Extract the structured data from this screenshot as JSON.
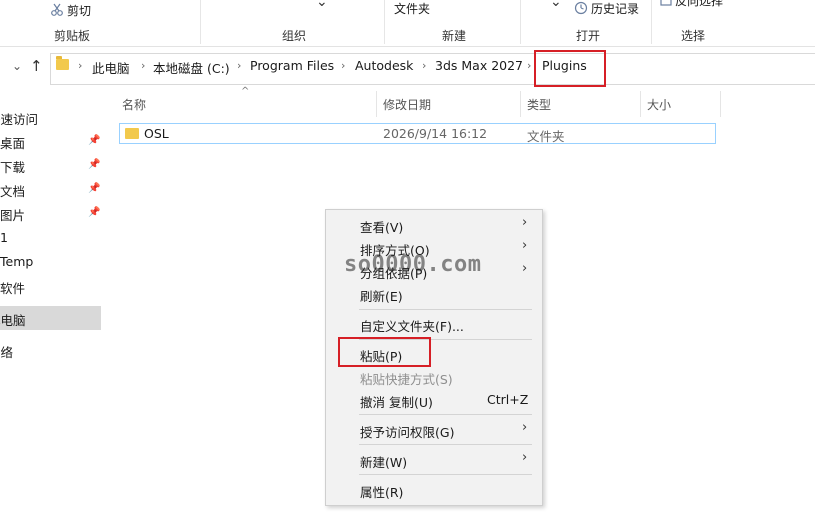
{
  "ribbon": {
    "cut_label": "剪切",
    "clipboard_group": "剪贴板",
    "organize_group": "组织",
    "folder_label": "文件夹",
    "new_group": "新建",
    "history_label": "历史记录",
    "open_group": "打开",
    "select_label_partial": "反向选择",
    "select_group": "选择"
  },
  "address_bar": {
    "crumbs": [
      "此电脑",
      "本地磁盘 (C:)",
      "Program Files",
      "Autodesk",
      "3ds Max 2027",
      "Plugins"
    ]
  },
  "sidebar": {
    "items": [
      {
        "label": "快速访问",
        "pinned": false
      },
      {
        "label": "桌面",
        "pinned": true
      },
      {
        "label": "下载",
        "pinned": true
      },
      {
        "label": "文档",
        "pinned": true
      },
      {
        "label": "图片",
        "pinned": true
      },
      {
        "label": "1",
        "pinned": false
      },
      {
        "label": "Temp",
        "pinned": false
      },
      {
        "label": "软件",
        "pinned": false
      },
      {
        "label": "此电脑",
        "pinned": false,
        "selected": true
      },
      {
        "label": "网络",
        "pinned": false
      }
    ]
  },
  "file_list": {
    "columns": [
      "名称",
      "修改日期",
      "类型",
      "大小"
    ],
    "rows": [
      {
        "name": "OSL",
        "modified": "2026/9/14 16:12",
        "type": "文件夹",
        "size": ""
      }
    ]
  },
  "context_menu": {
    "items": {
      "view": "查看(V)",
      "sort": "排序方式(O)",
      "group": "分组依据(P)",
      "refresh": "刷新(E)",
      "customize": "自定义文件夹(F)...",
      "paste": "粘贴(P)",
      "paste_shortcut": "粘贴快捷方式(S)",
      "undo_copy": "撤消 复制(U)",
      "undo_shortcut": "Ctrl+Z",
      "grant_access": "授予访问权限(G)",
      "new": "新建(W)",
      "properties": "属性(R)"
    }
  },
  "watermark": "so0000.com",
  "colors": {
    "highlight_box": "#d61f26",
    "folder": "#f2c94c",
    "selection_border": "#99d1ff"
  }
}
